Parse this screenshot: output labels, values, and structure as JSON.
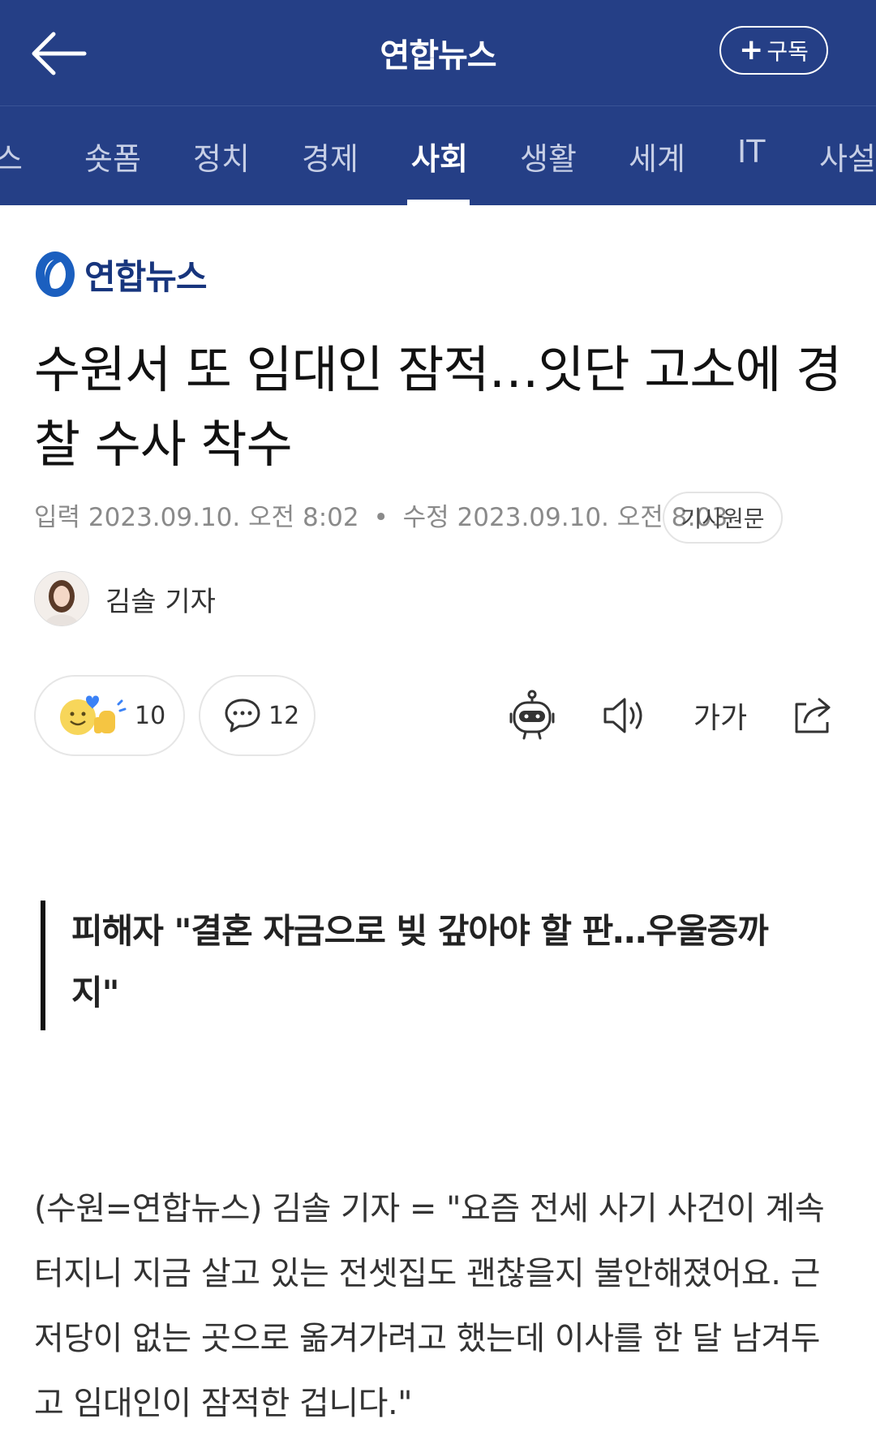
{
  "header": {
    "back_icon": "back-arrow-icon",
    "title": "연합뉴스",
    "subscribe_label": "구독",
    "subscribe_icon": "plus-icon"
  },
  "categories": {
    "items": [
      {
        "label": "뉴스"
      },
      {
        "label": "숏폼"
      },
      {
        "label": "정치"
      },
      {
        "label": "경제"
      },
      {
        "label": "사회"
      },
      {
        "label": "생활"
      },
      {
        "label": "세계"
      },
      {
        "label": "IT"
      },
      {
        "label": "사설"
      }
    ],
    "active": "사회"
  },
  "article": {
    "publisher_logo_text": "연합뉴스",
    "headline": "수원서 또 임대인 잠적…잇단 고소에 경찰 수사 착수",
    "published_label": "입력",
    "published": "2023.09.10. 오전 8:02",
    "modified_label": "수정",
    "modified": "2023.09.10. 오전 8:03",
    "separator": "•",
    "original_link_label": "기사원문",
    "reporter": "김솔 기자",
    "reaction_count": "10",
    "comment_count": "12",
    "subheading": "피해자 \"결혼 자금으로 빚 갚아야 할 판…우울증까지\"",
    "body": "(수원=연합뉴스) 김솔 기자 = \"요즘 전세 사기 사건이 계속 터지니 지금 살고 있는 전셋집도 괜찮을지 불안해졌어요. 근저당이 없는 곳으로 옮겨가려고 했는데 이사를 한 달 남겨두고 임대인이 잠적한 겁니다.\""
  },
  "toolbar": {
    "summary_icon": "robot-icon",
    "tts_icon": "speaker-icon",
    "font_size_label": "가가",
    "share_icon": "share-icon"
  },
  "colors": {
    "header_bg": "#253f86",
    "accent": "#17357d"
  }
}
